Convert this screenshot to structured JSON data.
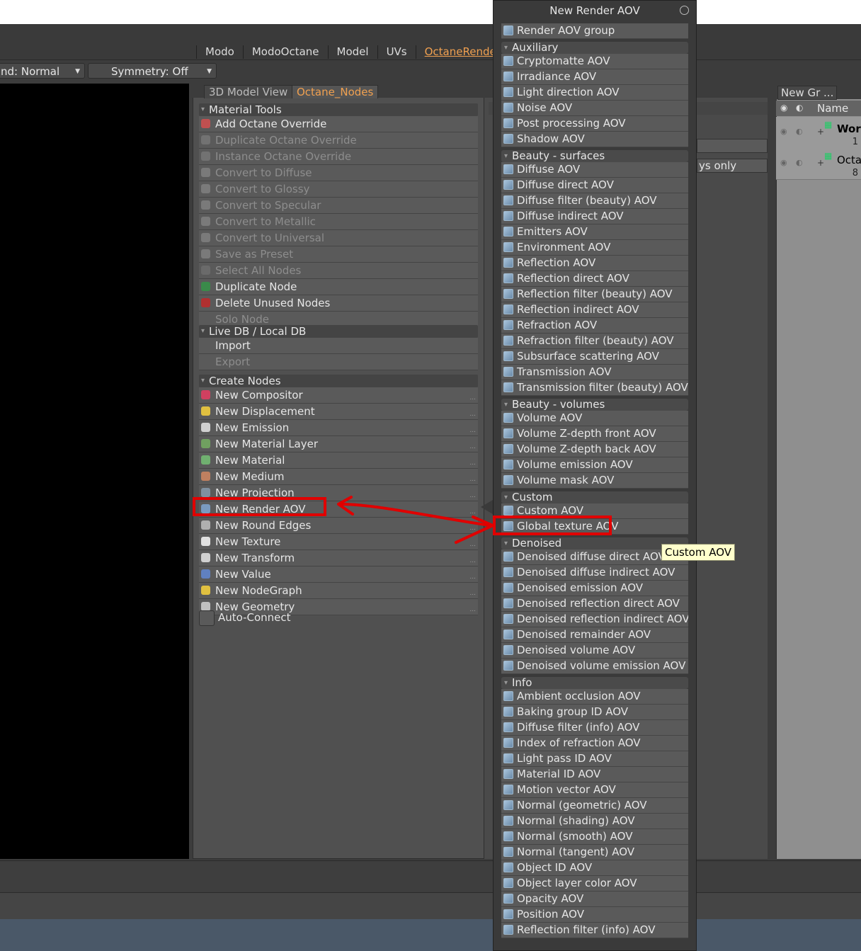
{
  "top_tabs": [
    "Modo",
    "ModoOctane",
    "Model",
    "UVs",
    "OctaneRender"
  ],
  "top_tabs_active": "OctaneRender",
  "toolbar": {
    "mode_dropdown": "nd: Normal",
    "symmetry_dropdown": "Symmetry: Off"
  },
  "panel_tabs": [
    "3D Model View",
    "Octane_Nodes"
  ],
  "panel_tabs_active": "Octane_Nodes",
  "material_tools": {
    "title": "Material Tools",
    "items": [
      {
        "label": "Add Octane Override",
        "enabled": true
      },
      {
        "label": "Duplicate Octane Override",
        "enabled": false
      },
      {
        "label": "Instance Octane Override",
        "enabled": false
      },
      {
        "label": "Convert to Diffuse",
        "enabled": false
      },
      {
        "label": "Convert to Glossy",
        "enabled": false
      },
      {
        "label": "Convert to Specular",
        "enabled": false
      },
      {
        "label": "Convert to Metallic",
        "enabled": false
      },
      {
        "label": "Convert to Universal",
        "enabled": false
      },
      {
        "label": "Save as Preset",
        "enabled": false
      },
      {
        "label": "Select All Nodes",
        "enabled": false
      },
      {
        "label": "Duplicate Node",
        "enabled": true
      },
      {
        "label": "Delete Unused Nodes",
        "enabled": true
      },
      {
        "label": "Solo Node",
        "enabled": false
      }
    ]
  },
  "live_db": {
    "title": "Live DB / Local DB",
    "items": [
      {
        "label": "Import",
        "enabled": true
      },
      {
        "label": "Export",
        "enabled": false
      }
    ]
  },
  "create_nodes": {
    "title": "Create Nodes",
    "items": [
      "New Compositor",
      "New Displacement",
      "New Emission",
      "New Material Layer",
      "New Material",
      "New Medium",
      "New Projection",
      "New Render AOV",
      "New Round Edges",
      "New Texture",
      "New Transform",
      "New Value",
      "New NodeGraph",
      "New Geometry"
    ]
  },
  "auto_connect_label": "Auto-Connect",
  "mid_panel_dropdown2": "ys only",
  "right_panel": {
    "tab": "New Gr ...",
    "column_name": "Name",
    "rows": [
      {
        "label": "Wor",
        "count": "1"
      },
      {
        "label": "Octar",
        "count": "8"
      }
    ]
  },
  "popup": {
    "title": "New Render AOV",
    "top_item": "Render AOV group",
    "sections": [
      {
        "title": "Auxiliary",
        "items": [
          "Cryptomatte AOV",
          "Irradiance AOV",
          "Light direction AOV",
          "Noise AOV",
          "Post processing AOV",
          "Shadow AOV"
        ]
      },
      {
        "title": "Beauty - surfaces",
        "items": [
          "Diffuse AOV",
          "Diffuse direct AOV",
          "Diffuse filter (beauty) AOV",
          "Diffuse indirect AOV",
          "Emitters AOV",
          "Environment AOV",
          "Reflection AOV",
          "Reflection direct AOV",
          "Reflection filter (beauty) AOV",
          "Reflection indirect AOV",
          "Refraction AOV",
          "Refraction filter (beauty) AOV",
          "Subsurface scattering AOV",
          "Transmission AOV",
          "Transmission filter (beauty) AOV"
        ]
      },
      {
        "title": "Beauty - volumes",
        "items": [
          "Volume AOV",
          "Volume Z-depth front AOV",
          "Volume Z-depth back AOV",
          "Volume emission AOV",
          "Volume mask AOV"
        ]
      },
      {
        "title": "Custom",
        "items": [
          "Custom AOV",
          "Global texture AOV"
        ]
      },
      {
        "title": "Denoised",
        "items": [
          "Denoised diffuse direct AOV",
          "Denoised diffuse indirect AOV",
          "Denoised emission AOV",
          "Denoised reflection direct AOV",
          "Denoised reflection indirect AOV",
          "Denoised remainder AOV",
          "Denoised volume AOV",
          "Denoised volume emission AOV"
        ]
      },
      {
        "title": "Info",
        "items": [
          "Ambient occlusion AOV",
          "Baking group ID AOV",
          "Diffuse filter (info) AOV",
          "Index of refraction AOV",
          "Light pass ID AOV",
          "Material ID AOV",
          "Motion vector AOV",
          "Normal (geometric) AOV",
          "Normal (shading) AOV",
          "Normal (smooth) AOV",
          "Normal (tangent) AOV",
          "Object ID AOV",
          "Object layer color AOV",
          "Opacity AOV",
          "Position AOV",
          "Reflection filter (info) AOV"
        ]
      }
    ]
  },
  "tooltip": "Custom AOV",
  "colors": {
    "accent_tab": "#f0a050",
    "annotation_red": "#e00000",
    "tooltip_bg": "#ffffcc"
  }
}
